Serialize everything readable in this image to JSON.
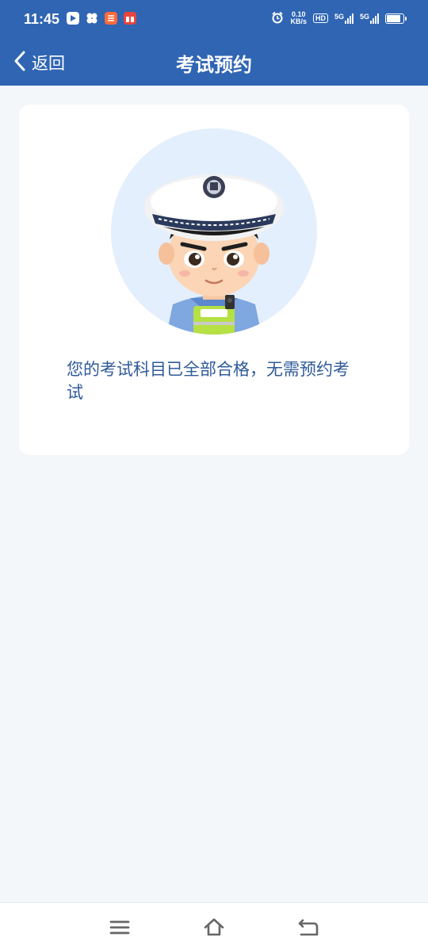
{
  "status_bar": {
    "time": "11:45",
    "net_speed_value": "0.10",
    "net_speed_unit": "KB/s",
    "hd_label": "HD",
    "network_1": "5G",
    "network_2": "5G",
    "battery_level": 0.95,
    "app_icons": [
      {
        "name": "video-app-icon",
        "color": "#ffffff"
      },
      {
        "name": "pinwheel-app-icon",
        "color": "#ffffff"
      },
      {
        "name": "taobao-app-icon",
        "color": "#ff6a3a"
      },
      {
        "name": "gift-app-icon",
        "color": "#e8453c"
      }
    ]
  },
  "navbar": {
    "back_label": "返回",
    "title": "考试预约"
  },
  "card": {
    "illustration": "traffic-police-avatar",
    "message": "您的考试科目已全部合格，无需预约考试"
  },
  "bottom_nav": {
    "menu_icon": "menu-icon",
    "home_icon": "home-icon",
    "back_icon": "back-arrow-icon"
  },
  "colors": {
    "primary": "#2f65b3",
    "page_background": "#f4f7f9",
    "card_background": "#ffffff",
    "message_text": "#2f5a99"
  }
}
